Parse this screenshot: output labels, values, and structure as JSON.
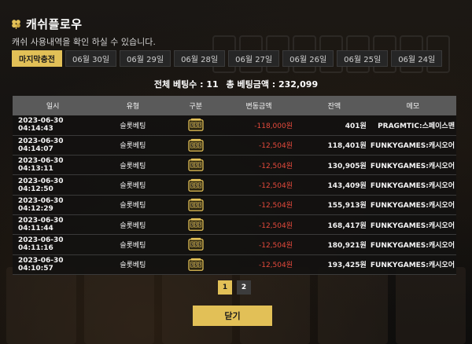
{
  "header": {
    "title": "캐쉬플로우",
    "subtitle": "캐쉬 사용내역을 확인 하실 수 있습니다."
  },
  "tabs": [
    "마지막충전",
    "06월 30일",
    "06월 29일",
    "06월 28일",
    "06월 27일",
    "06월 26일",
    "06월 25일",
    "06월 24일"
  ],
  "active_tab": 0,
  "summary": {
    "bet_count": "전체 베팅수 : 11",
    "bet_total": "총 베팅금액 : 232,099"
  },
  "table": {
    "columns": [
      "일시",
      "유형",
      "구분",
      "변동금액",
      "잔액",
      "메모"
    ],
    "rows": [
      {
        "time": "2023-06-30 04:14:43",
        "type": "슬롯베팅",
        "icon": "slot-icon",
        "amount": "-118,000원",
        "balance": "401원",
        "memo": "PRAGMTIC:스페이스맨"
      },
      {
        "time": "2023-06-30 04:14:07",
        "type": "슬롯베팅",
        "icon": "slot-icon",
        "amount": "-12,504원",
        "balance": "118,401원",
        "memo": "FUNKYGAMES:캐시오어"
      },
      {
        "time": "2023-06-30 04:13:11",
        "type": "슬롯베팅",
        "icon": "slot-icon",
        "amount": "-12,504원",
        "balance": "130,905원",
        "memo": "FUNKYGAMES:캐시오어"
      },
      {
        "time": "2023-06-30 04:12:50",
        "type": "슬롯베팅",
        "icon": "slot-icon",
        "amount": "-12,504원",
        "balance": "143,409원",
        "memo": "FUNKYGAMES:캐시오어"
      },
      {
        "time": "2023-06-30 04:12:29",
        "type": "슬롯베팅",
        "icon": "slot-icon",
        "amount": "-12,504원",
        "balance": "155,913원",
        "memo": "FUNKYGAMES:캐시오어"
      },
      {
        "time": "2023-06-30 04:11:44",
        "type": "슬롯베팅",
        "icon": "slot-icon",
        "amount": "-12,504원",
        "balance": "168,417원",
        "memo": "FUNKYGAMES:캐시오어"
      },
      {
        "time": "2023-06-30 04:11:16",
        "type": "슬롯베팅",
        "icon": "slot-icon",
        "amount": "-12,504원",
        "balance": "180,921원",
        "memo": "FUNKYGAMES:캐시오어"
      },
      {
        "time": "2023-06-30 04:10:57",
        "type": "슬롯베팅",
        "icon": "slot-icon",
        "amount": "-12,504원",
        "balance": "193,425원",
        "memo": "FUNKYGAMES:캐시오어"
      }
    ]
  },
  "pagination": {
    "pages": [
      "1",
      "2"
    ],
    "current": 0
  },
  "close_label": "닫기",
  "colors": {
    "accent": "#e2c057",
    "negative": "#e64a3c",
    "header_row": "#5a5a5a"
  }
}
